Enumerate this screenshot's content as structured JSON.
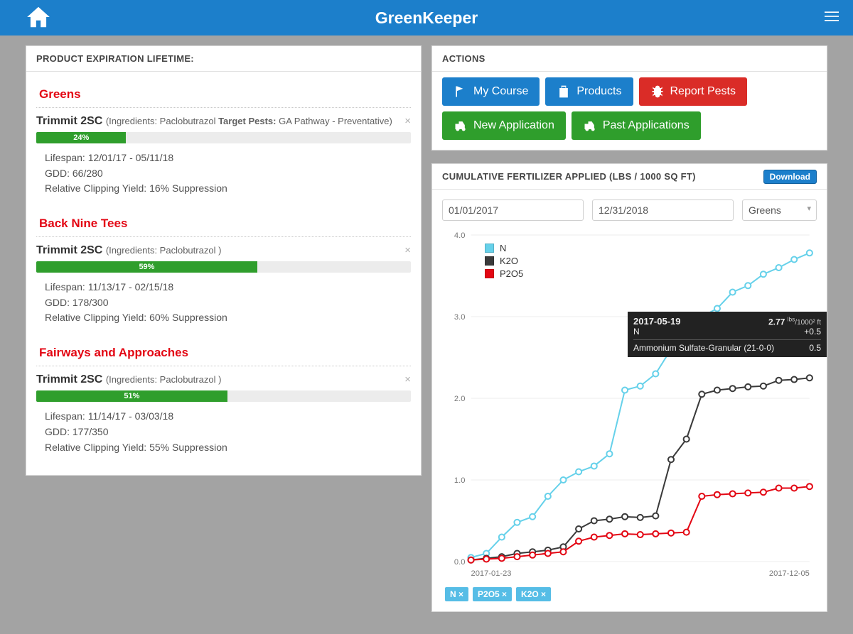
{
  "header": {
    "title": "GreenKeeper"
  },
  "left_panel": {
    "title": "PRODUCT EXPIRATION LIFETIME:",
    "sections": [
      {
        "name": "Greens",
        "product_name": "Trimmit 2SC",
        "meta_prefix": " (Ingredients: ",
        "ingredients": "Paclobutrazol",
        "target_pests_label": " Target Pests: ",
        "target_pests": "GA Pathway - Preventative)",
        "pct": "24%",
        "pct_w": 24,
        "lifespan": "Lifespan: 12/01/17 - 05/11/18",
        "gdd": "GDD: 66/280",
        "rcy": "Relative Clipping Yield: 16% Suppression"
      },
      {
        "name": "Back Nine Tees",
        "product_name": "Trimmit 2SC",
        "meta_prefix": " (Ingredients: ",
        "ingredients": "Paclobutrazol )",
        "target_pests_label": "",
        "target_pests": "",
        "pct": "59%",
        "pct_w": 59,
        "lifespan": "Lifespan: 11/13/17 - 02/15/18",
        "gdd": "GDD: 178/300",
        "rcy": "Relative Clipping Yield: 60% Suppression"
      },
      {
        "name": "Fairways and Approaches",
        "product_name": "Trimmit 2SC",
        "meta_prefix": " (Ingredients: ",
        "ingredients": "Paclobutrazol )",
        "target_pests_label": "",
        "target_pests": "",
        "pct": "51%",
        "pct_w": 51,
        "lifespan": "Lifespan: 11/14/17 - 03/03/18",
        "gdd": "GDD: 177/350",
        "rcy": "Relative Clipping Yield: 55% Suppression"
      }
    ]
  },
  "actions": {
    "title": "ACTIONS",
    "buttons": [
      {
        "label": "My Course",
        "color": "blue"
      },
      {
        "label": "Products",
        "color": "blue"
      },
      {
        "label": "Report Pests",
        "color": "red"
      },
      {
        "label": "New Application",
        "color": "green"
      },
      {
        "label": "Past Applications",
        "color": "green"
      }
    ]
  },
  "chart_panel": {
    "title": "CUMULATIVE FERTILIZER APPLIED (LBS / 1000 SQ FT)",
    "download": "Download",
    "date_from": "01/01/2017",
    "date_to": "12/31/2018",
    "area": "Greens",
    "x_start": "2017-01-23",
    "x_end": "2017-12-05",
    "tooltip": {
      "date": "2017-05-19",
      "value": "2.77",
      "unit_top": "lbs",
      "unit_bot": "/1000² ft",
      "series": "N",
      "delta": "+0.5",
      "detail_name": "Ammonium Sulfate-Granular (21-0-0)",
      "detail_val": "0.5"
    },
    "tags": [
      "N ×",
      "P2O5 ×",
      "K2O ×"
    ],
    "legend": [
      {
        "name": "N",
        "color": "#66d1ea"
      },
      {
        "name": "K2O",
        "color": "#3a3a3a"
      },
      {
        "name": "P2O5",
        "color": "#e30613"
      }
    ]
  },
  "chart_data": {
    "type": "line",
    "title": "Cumulative Fertilizer Applied (lbs / 1000 sq ft)",
    "xlabel": "",
    "ylabel": "",
    "ylim": [
      0,
      4.0
    ],
    "x_range": [
      "2017-01-23",
      "2017-12-05"
    ],
    "y_ticks": [
      0,
      1.0,
      2.0,
      3.0,
      4.0
    ],
    "series": [
      {
        "name": "N",
        "color": "#66d1ea",
        "x": [
          0,
          1,
          2,
          3,
          4,
          5,
          6,
          7,
          8,
          9,
          10,
          11,
          12,
          13,
          14,
          15,
          16,
          17,
          18,
          19,
          20,
          21,
          22
        ],
        "y": [
          0.05,
          0.1,
          0.3,
          0.48,
          0.55,
          0.8,
          1.0,
          1.1,
          1.17,
          1.32,
          2.1,
          2.15,
          2.3,
          2.6,
          2.77,
          3.0,
          3.1,
          3.3,
          3.38,
          3.52,
          3.6,
          3.7,
          3.78
        ]
      },
      {
        "name": "K2O",
        "color": "#3a3a3a",
        "x": [
          0,
          1,
          2,
          3,
          4,
          5,
          6,
          7,
          8,
          9,
          10,
          11,
          12,
          13,
          14,
          15,
          16,
          17,
          18,
          19,
          20,
          21,
          22
        ],
        "y": [
          0.02,
          0.04,
          0.06,
          0.1,
          0.12,
          0.14,
          0.18,
          0.4,
          0.5,
          0.52,
          0.55,
          0.54,
          0.56,
          1.25,
          1.5,
          2.05,
          2.1,
          2.12,
          2.14,
          2.15,
          2.22,
          2.23,
          2.25
        ]
      },
      {
        "name": "P2O5",
        "color": "#e30613",
        "x": [
          0,
          1,
          2,
          3,
          4,
          5,
          6,
          7,
          8,
          9,
          10,
          11,
          12,
          13,
          14,
          15,
          16,
          17,
          18,
          19,
          20,
          21,
          22
        ],
        "y": [
          0.02,
          0.03,
          0.04,
          0.06,
          0.08,
          0.1,
          0.12,
          0.25,
          0.3,
          0.32,
          0.34,
          0.33,
          0.34,
          0.35,
          0.36,
          0.8,
          0.82,
          0.83,
          0.84,
          0.85,
          0.9,
          0.9,
          0.92
        ]
      }
    ]
  }
}
